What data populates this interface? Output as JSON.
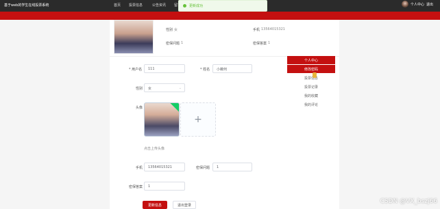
{
  "app": {
    "title": "基于web的学生在线投票系统",
    "nav": [
      "首页",
      "投票信息",
      "公告资讯",
      "留言"
    ]
  },
  "toast": {
    "text": "更新成功"
  },
  "user": {
    "name": "个人中心",
    "logout": "退出"
  },
  "profile_summary": {
    "gender_label": "性别",
    "gender_value": "女",
    "phone_label": "手机",
    "phone_value": "13564015321",
    "question_label": "密保问题",
    "question_value": "1",
    "answer_label": "密保答案",
    "answer_value": "1"
  },
  "form": {
    "username_label": "* 用户名",
    "username_value": "111",
    "name_label": "* 姓名",
    "name_value": "小薇何",
    "gender_label": "性别",
    "gender_value": "女",
    "avatar_label": "头像",
    "avatar_hint": "点击上传头像",
    "phone_label": "手机",
    "phone_value": "13564015321",
    "question_label": "密保问题",
    "question_value": "1",
    "answer_label": "密保答案",
    "answer_value": "1",
    "upload_plus": "+",
    "update_button": "更新信息",
    "logout_button": "退出登录"
  },
  "sidebar": {
    "items": [
      {
        "label": "个人中心"
      },
      {
        "label": "修改密码"
      },
      {
        "label": "投票信息"
      },
      {
        "label": "投票记录"
      },
      {
        "label": "我的收藏"
      },
      {
        "label": "我的评论"
      }
    ]
  },
  "watermark": {
    "text": "CSDN @VX_bszj66"
  },
  "colors": {
    "accent": "#c41010",
    "success": "#67c23a"
  }
}
